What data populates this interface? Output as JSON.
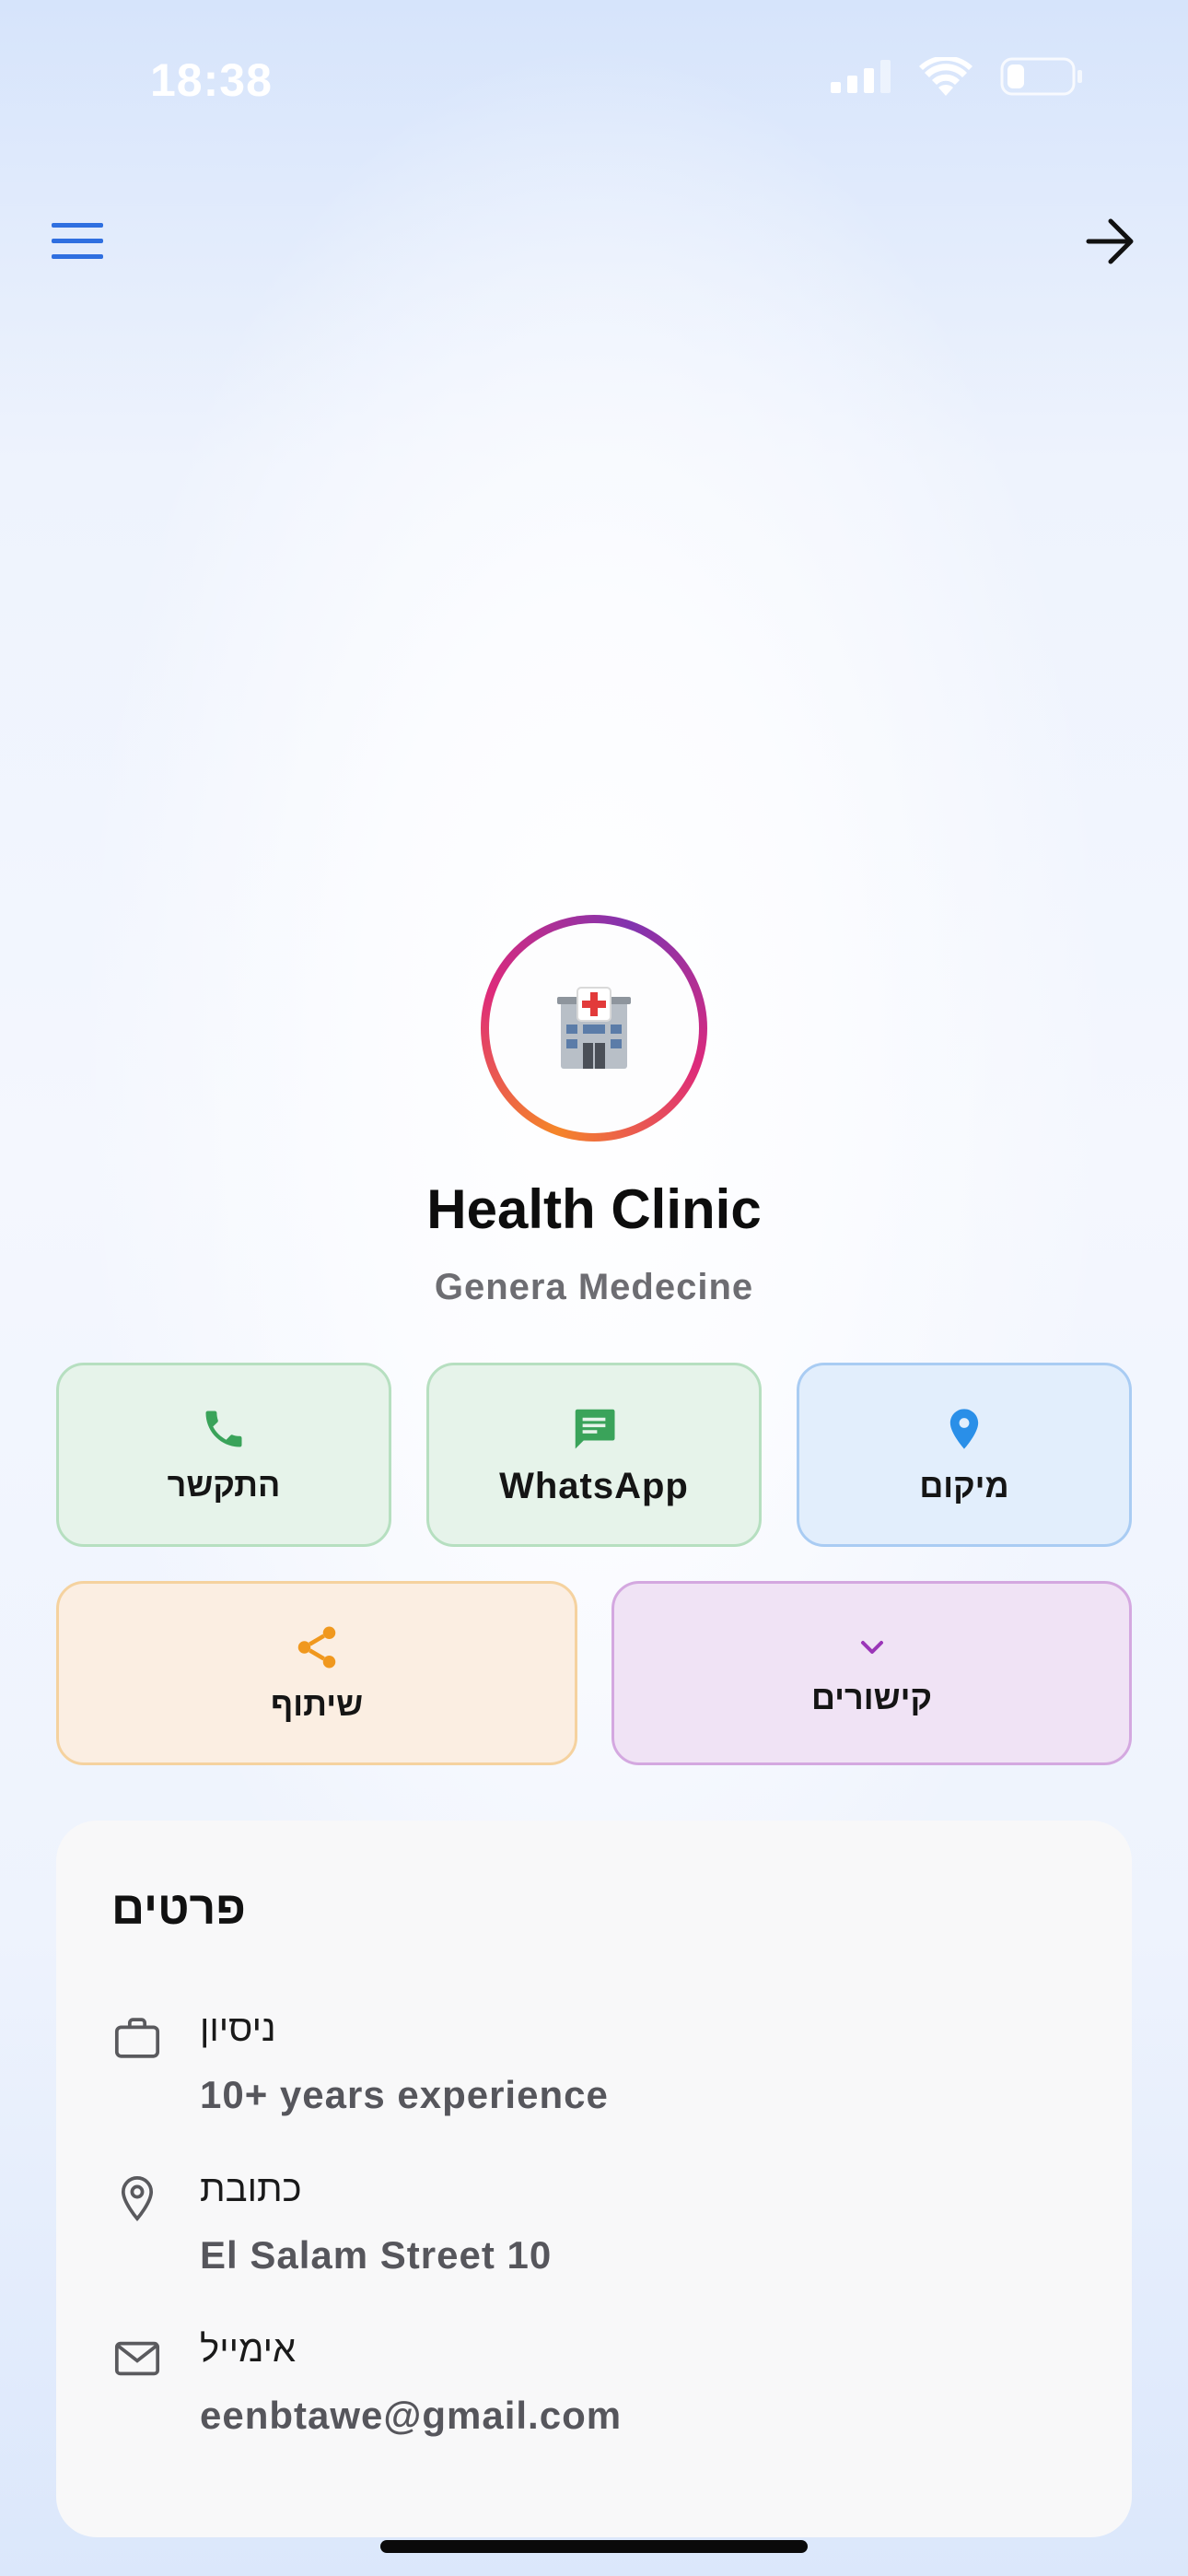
{
  "status_bar": {
    "time": "18:38"
  },
  "header": {
    "menu_icon": "hamburger-menu-icon",
    "forward_icon": "arrow-right-icon"
  },
  "profile": {
    "avatar_emoji": "🏥",
    "name": "Health Clinic",
    "category": "Genera Medecine"
  },
  "actions": {
    "call": {
      "label": "התקשר",
      "icon": "phone-icon",
      "color": "#3aa35a"
    },
    "whatsapp": {
      "label": "WhatsApp",
      "icon": "chat-icon",
      "color": "#3aa35a"
    },
    "location": {
      "label": "מיקום",
      "icon": "location-pin-icon",
      "color": "#2a8fe8"
    },
    "share": {
      "label": "שיתוף",
      "icon": "share-icon",
      "color": "#f0981e"
    },
    "links": {
      "label": "קישורים",
      "icon": "chevron-down-icon",
      "color": "#9b36b8"
    }
  },
  "details": {
    "title": "פרטים",
    "items": [
      {
        "icon": "briefcase-icon",
        "label": "ניסיון",
        "value": "10+ years experience"
      },
      {
        "icon": "location-pin-icon",
        "label": "כתובת",
        "value": "El Salam Street 10"
      },
      {
        "icon": "mail-icon",
        "label": "אימייל",
        "value": "eenbtawe@gmail.com"
      }
    ]
  }
}
